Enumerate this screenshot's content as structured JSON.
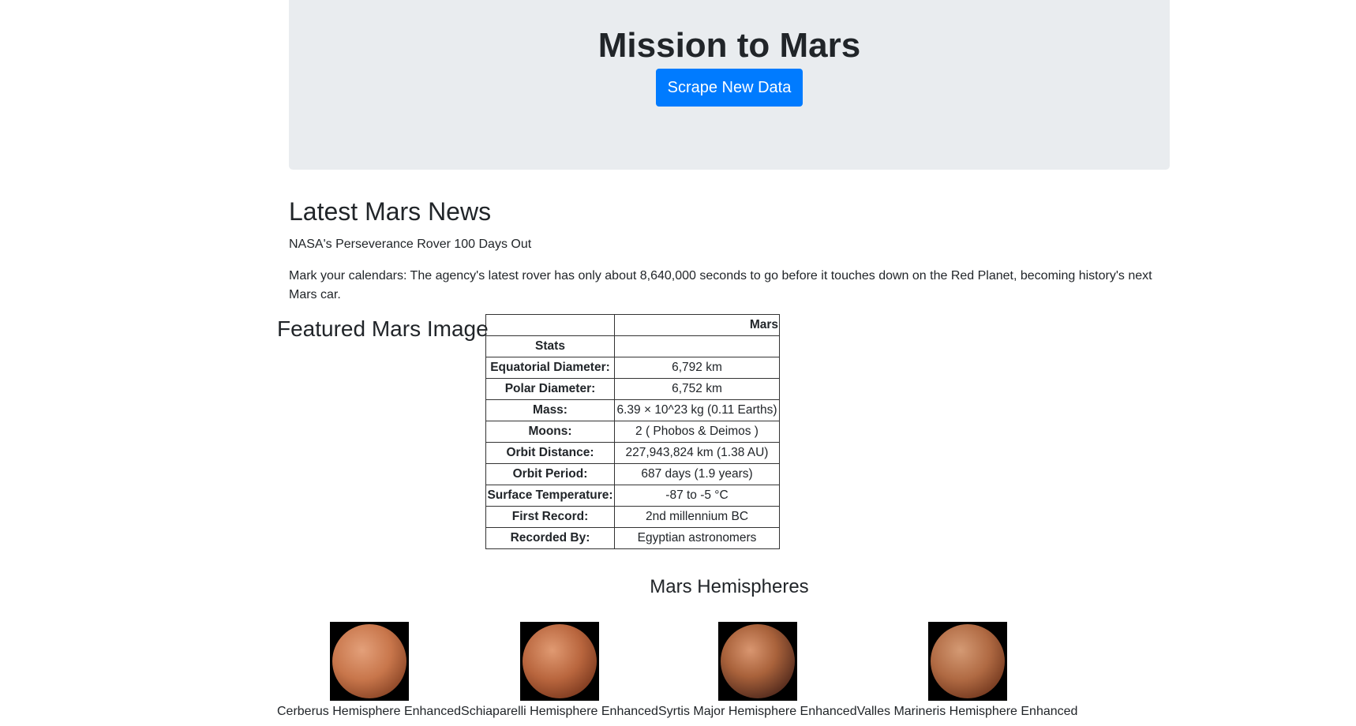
{
  "header": {
    "title": "Mission to Mars",
    "scrape_button": "Scrape New Data"
  },
  "news": {
    "section_title": "Latest Mars News",
    "headline": "NASA's Perseverance Rover 100 Days Out",
    "teaser": "Mark your calendars: The agency's latest rover has only about 8,640,000 seconds to go before it touches down on the Red Planet, becoming history's next Mars car."
  },
  "featured": {
    "title": "Featured Mars Image"
  },
  "facts": {
    "header_col2": "Mars",
    "stats_label": "Stats",
    "rows": [
      {
        "label": "Equatorial Diameter:",
        "value": "6,792 km"
      },
      {
        "label": "Polar Diameter:",
        "value": "6,752 km"
      },
      {
        "label": "Mass:",
        "value": "6.39 × 10^23 kg (0.11 Earths)"
      },
      {
        "label": "Moons:",
        "value": "2 ( Phobos & Deimos )"
      },
      {
        "label": "Orbit Distance:",
        "value": "227,943,824 km (1.38 AU)"
      },
      {
        "label": "Orbit Period:",
        "value": "687 days (1.9 years)"
      },
      {
        "label": "Surface Temperature:",
        "value": "-87 to -5 °C"
      },
      {
        "label": "First Record:",
        "value": "2nd millennium BC"
      },
      {
        "label": "Recorded By:",
        "value": "Egyptian astronomers"
      }
    ]
  },
  "hemispheres": {
    "title": "Mars Hemispheres",
    "items": [
      {
        "caption": "Cerberus Hemisphere Enhanced"
      },
      {
        "caption": "Schiaparelli Hemisphere Enhanced"
      },
      {
        "caption": "Syrtis Major Hemisphere Enhanced"
      },
      {
        "caption": "Valles Marineris Hemisphere Enhanced"
      }
    ]
  },
  "colors": {
    "jumbotron_bg": "#e9ecef",
    "button_bg": "#007bff",
    "button_text": "#ffffff"
  }
}
